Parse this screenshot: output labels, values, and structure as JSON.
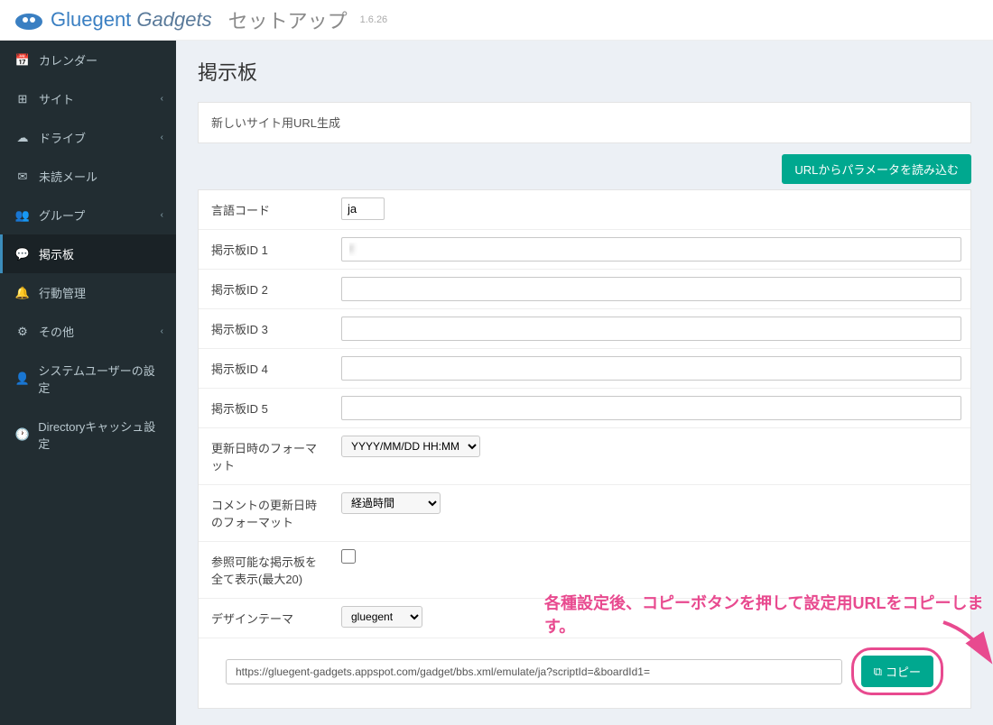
{
  "header": {
    "logo_part1": "Gluegent",
    "logo_part2": " Gadgets",
    "setup": "セットアップ",
    "version": "1.6.26"
  },
  "sidebar": {
    "items": [
      {
        "icon": "📅",
        "label": "カレンダー",
        "chev": false
      },
      {
        "icon": "⊞",
        "label": "サイト",
        "chev": true
      },
      {
        "icon": "☁",
        "label": "ドライブ",
        "chev": true
      },
      {
        "icon": "✉",
        "label": "未読メール",
        "chev": false
      },
      {
        "icon": "👥",
        "label": "グループ",
        "chev": true
      },
      {
        "icon": "💬",
        "label": "掲示板",
        "chev": false,
        "active": true
      },
      {
        "icon": "🔔",
        "label": "行動管理",
        "chev": false
      },
      {
        "icon": "⚙",
        "label": "その他",
        "chev": true
      },
      {
        "icon": "👤",
        "label": "システムユーザーの設定",
        "chev": false
      },
      {
        "icon": "🕐",
        "label": "Directoryキャッシュ設定",
        "chev": false
      }
    ]
  },
  "main": {
    "title": "掲示板",
    "panel_heading": "新しいサイト用URL生成",
    "load_btn": "URLからパラメータを読み込む",
    "rows": {
      "lang_label": "言語コード",
      "lang_value": "ja",
      "board1_label": "掲示板ID 1",
      "board1_value": "f",
      "board2_label": "掲示板ID 2",
      "board2_value": " ",
      "board3_label": "掲示板ID 3",
      "board3_value": " ",
      "board4_label": "掲示板ID 4",
      "board4_value": "",
      "board5_label": "掲示板ID 5",
      "board5_value": "",
      "datefmt_label": "更新日時のフォーマット",
      "datefmt_value": "YYYY/MM/DD HH:MM",
      "commentfmt_label": "コメントの更新日時のフォーマット",
      "commentfmt_value": "経過時間",
      "showall_label": "参照可能な掲示板を全て表示(最大20)",
      "theme_label": "デザインテーマ",
      "theme_value": "gluegent"
    },
    "url_value": "https://gluegent-gadgets.appspot.com/gadget/bbs.xml/emulate/ja?scriptId=&boardId1=",
    "copy_btn": "コピー",
    "annotation": "各種設定後、コピーボタンを押して設定用URLをコピーします。"
  }
}
